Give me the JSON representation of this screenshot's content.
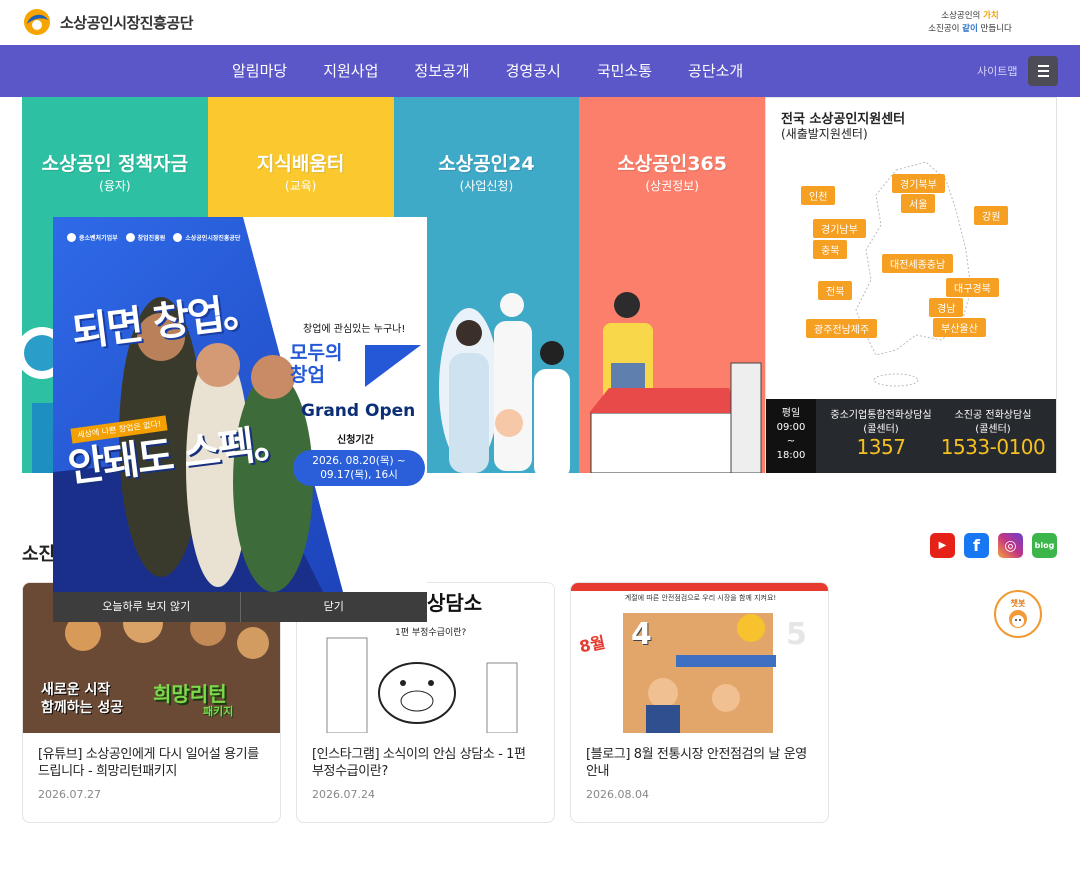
{
  "header": {
    "logo_text": "소상공인시장진흥공단",
    "slogan_line1_a": "소상공인의 ",
    "slogan_line1_b": "가치",
    "slogan_line2_a": "소진공이 ",
    "slogan_line2_b": "같이",
    "slogan_line2_c": " 만듭니다"
  },
  "nav": {
    "items": [
      "알림마당",
      "지원사업",
      "정보공개",
      "경영공시",
      "국민소통",
      "공단소개"
    ],
    "sitemap": "사이트맵"
  },
  "tiles": [
    {
      "title": "소상공인 정책자금",
      "sub": "(융자)",
      "color": "#2ec0a2"
    },
    {
      "title": "지식배움터",
      "sub": "(교육)",
      "color": "#fbc92d"
    },
    {
      "title": "소상공인24",
      "sub": "(사업신청)",
      "color": "#3fa9c8"
    },
    {
      "title": "소상공인365",
      "sub": "(상권정보)",
      "color": "#fb7f6a"
    }
  ],
  "center": {
    "title": "전국 소상공인지원센터",
    "subtitle": "(새출발지원센터)",
    "regions": [
      "인천",
      "경기북부",
      "서울",
      "강원",
      "경기남부",
      "충북",
      "대전세종충남",
      "전북",
      "대구경북",
      "경남",
      "광주전남제주",
      "부산울산"
    ],
    "hours": [
      "평일",
      "09:00",
      "~",
      "18:00"
    ],
    "phones": [
      {
        "label": "중소기업통합전화상담실",
        "sub": "(콜센터)",
        "number": "1357"
      },
      {
        "label": "소진공 전화상담실",
        "sub": "(콜센터)",
        "number": "1533-0100"
      }
    ]
  },
  "news": {
    "heading": "소진",
    "sns": [
      {
        "name": "youtube",
        "color": "#e62117",
        "glyph": "▶"
      },
      {
        "name": "facebook",
        "color": "#1877f2",
        "glyph": "f"
      },
      {
        "name": "instagram",
        "color": "#c13584",
        "glyph": "◎"
      },
      {
        "name": "blog",
        "color": "#3cb54a",
        "glyph": "blog"
      }
    ],
    "cards": [
      {
        "title": "[유튜브] 소상공인에게 다시 일어설 용기를 드립니다 - 희망리턴패키지",
        "date": "2026.07.27",
        "thumb_text_1": "새로운 시작",
        "thumb_text_2": "함께하는 성공",
        "thumb_text_3": "희망리턴",
        "thumb_text_4": "패키지"
      },
      {
        "title": "[인스타그램] 소식이의 안심 상담소 - 1편 부정수급이란?",
        "date": "2026.07.24",
        "thumb_text_1": "상담소",
        "thumb_text_2": "1편 부정수급이란?"
      },
      {
        "title": "[블로그] 8월 전통시장 안전점검의 날 운영 안내",
        "date": "2026.08.04",
        "thumb_text_1": "계절에 따른 안전점검으로 우리 시장을 함께 지켜요!",
        "thumb_text_2": "8월",
        "thumb_text_3": "4",
        "thumb_text_4": "5"
      }
    ]
  },
  "chatbot": {
    "label": "챗봇"
  },
  "popup": {
    "logos": [
      "중소벤처기업부",
      "창업진흥원",
      "소상공인시장진흥공단"
    ],
    "headline_top": "되면 창업。",
    "ribbon": "세상에 나쁜 창업은 없다!",
    "headline_bottom": "안돼도 스펙。",
    "question": "창업에 관심있는 누구나!",
    "brand_line1": "모두의",
    "brand_line2": "창업",
    "grand_open": "Grand Open",
    "period_label": "신청기간",
    "date_line1": "2026. 08.20(목) ~",
    "date_line2": "09.17(목), 16시",
    "btn_hide_today": "오늘하루 보지 않기",
    "btn_close": "닫기"
  }
}
